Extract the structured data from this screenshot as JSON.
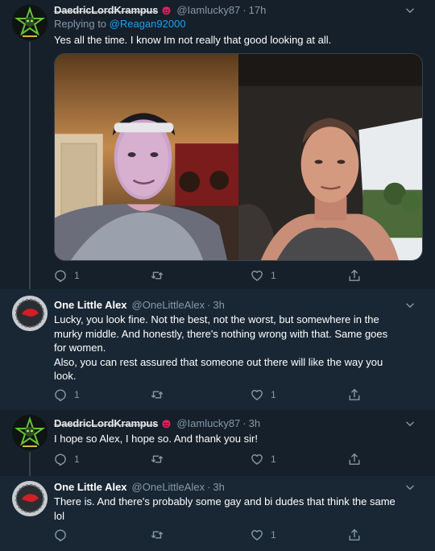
{
  "tweets": [
    {
      "display_name": "DaedricLordKrampus",
      "handle": "@Iamlucky87",
      "time": "17h",
      "replying_label": "Replying to",
      "replying_to": "@Reagan92000",
      "text": "Yes all the time.  I know Im not really that good looking at all.",
      "counts": {
        "replies": "1",
        "retweets": "",
        "likes": "1"
      }
    },
    {
      "display_name": "One Little Alex",
      "handle": "@OneLittleAlex",
      "time": "3h",
      "text_lines": [
        "Lucky, you look fine. Not the best, not the worst, but somewhere in the",
        "murky middle. And honestly, there's nothing wrong with that. Same goes",
        "for women.",
        "Also, you can rest assured that someone out there will like the way you",
        "look."
      ],
      "counts": {
        "replies": "1",
        "retweets": "",
        "likes": "1"
      }
    },
    {
      "display_name": "DaedricLordKrampus",
      "handle": "@Iamlucky87",
      "time": "3h",
      "text": "I hope so Alex, I hope so.  And thank you sir!",
      "counts": {
        "replies": "1",
        "retweets": "",
        "likes": "1"
      }
    },
    {
      "display_name": "One Little Alex",
      "handle": "@OneLittleAlex",
      "time": "3h",
      "text_lines": [
        "There is. And there's probably some gay and bi dudes that think the same",
        "lol"
      ],
      "counts": {
        "replies": "",
        "retweets": "",
        "likes": "1"
      }
    }
  ],
  "icons": {
    "reply": "reply-icon",
    "retweet": "retweet-icon",
    "like": "heart-icon",
    "share": "share-icon",
    "more": "chevron-down-icon",
    "emoji": "devil-emoji-icon"
  },
  "colors": {
    "background": "#15202b",
    "background_alt": "#192734",
    "text": "#ffffff",
    "secondary": "#8899a6",
    "link": "#1da1f2",
    "border": "#38444d"
  }
}
